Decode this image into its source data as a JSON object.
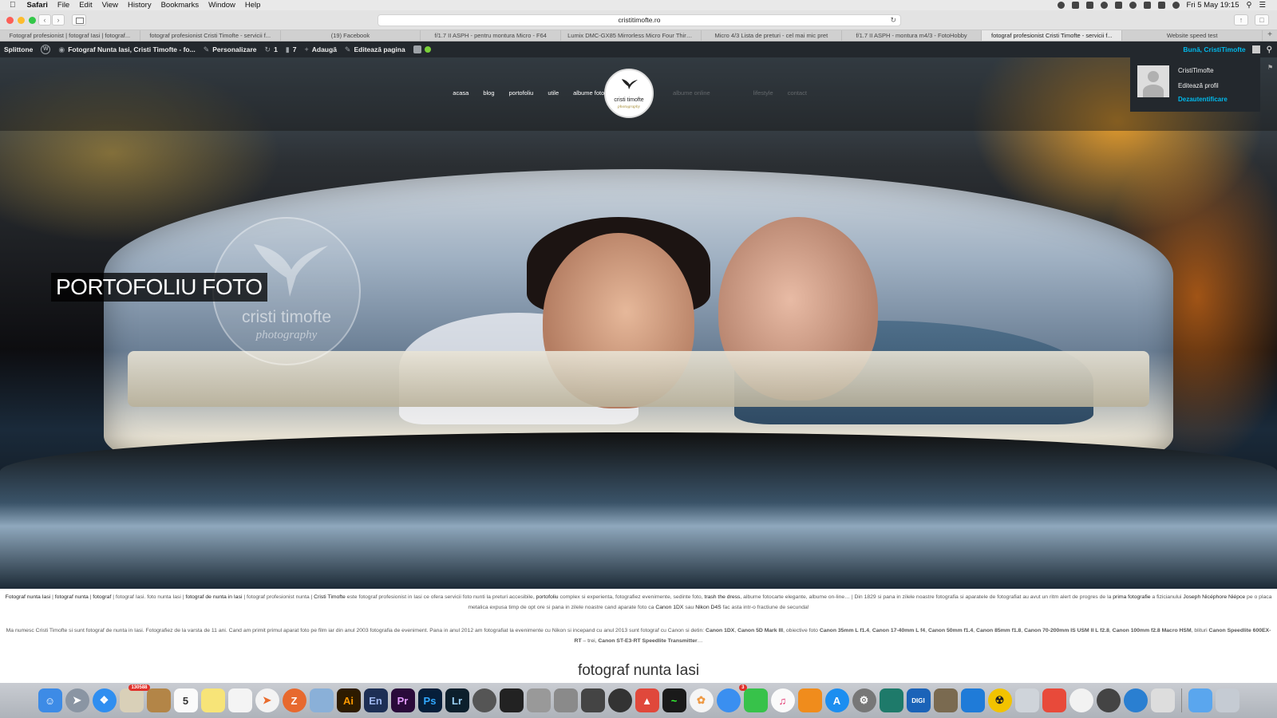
{
  "menubar": {
    "app": "Safari",
    "items": [
      "File",
      "Edit",
      "View",
      "History",
      "Bookmarks",
      "Window",
      "Help"
    ],
    "clock": "Fri 5 May  19:15"
  },
  "browser": {
    "url": "cristitimofte.ro",
    "tabs": [
      "Fotograf profesionist | fotograf Iasi | fotograf...",
      "fotograf profesionist Cristi Timofte - servicii f...",
      "(19) Facebook",
      "f/1.7 II ASPH - pentru montura Micro - F64",
      "Lumix DMC-GX85 Mirrorless Micro Four Third...",
      "Micro 4/3 Lista de preturi - cel mai mic pret",
      "f/1.7 II ASPH - montura m4/3 - FotoHobby",
      "fotograf profesionist Cristi Timofte - servicii f...",
      "Website speed test"
    ],
    "active_tab_index": 7
  },
  "adminbar": {
    "splittone": "Splittone",
    "site_title": "Fotograf Nunta Iasi, Cristi Timofte - fo...",
    "customize": "Personalizare",
    "updates_count": "1",
    "comments_count": "7",
    "add_new": "Adaugă",
    "edit_page": "Editează pagina",
    "howdy": "Bună, CristiTimofte"
  },
  "profile_menu": {
    "username": "CristiTimofte",
    "edit_profile": "Editează profil",
    "logout": "Dezautentificare"
  },
  "site_nav": {
    "left": [
      "acasa",
      "blog",
      "portofoliu",
      "utile",
      "albume fotocarte"
    ],
    "right": [
      "albume online",
      "",
      "",
      "lifestyle",
      "contact"
    ]
  },
  "logo": {
    "name": "cristi timofte",
    "sub": "photography"
  },
  "hero": {
    "title": "PORTOFOLIU FOTO",
    "watermark_name": "cristi timofte",
    "watermark_sub": "photography"
  },
  "intro": {
    "seg_1": "Fotograf nunta Iasi",
    "seg_2": " | ",
    "seg_3": "fotograf nunta",
    "seg_4": " | ",
    "seg_5": "fotograf",
    "seg_6": " | fotograf Iasi. foto nunta Iasi | ",
    "seg_7": "fotograf de nunta in Iasi",
    "seg_8": " | fotograf profesionist nunta | ",
    "seg_9": "Cristi Timofte",
    "seg_10": " este fotograf profesionist in Iasi ce ofera servicii foto nunti la preturi accesibile, ",
    "seg_11": "portofoliu",
    "seg_12": " complex si experienta, fotografiez evenimente, sedinte foto, ",
    "seg_13": "trash the dress",
    "seg_14": ", albume fotocarte elegante, albume on-line… | Din 1829 si pana in zilele noastre fotografia si aparatele de fotografiat au avut un ritm alert de progres de la ",
    "seg_15": "prima fotografie",
    "seg_16": " a fizicianului ",
    "seg_17": "Joseph Nicéphore Niépce",
    "seg_18": " pe o placa metalica expusa timp de opt ore si pana in zilele noastre cand aparate foto ca ",
    "seg_19": "Canon 1DX",
    "seg_20": " sau ",
    "seg_21": "Nikon D4S",
    "seg_22": " fac asta intr-o fractiune de secunda!"
  },
  "about": {
    "seg_1": "Ma numesc Cristi Timofte si sunt fotograf de nunta in Iasi. Fotografiez de la varsta de 11 ani. Cand am primit primul aparat foto pe film iar din anul 2003 fotografia de eveniment. Pana in anul 2012 am fotografiat la evenimente cu Nikon si incepand cu anul 2013 sunt fotograf cu Canon si detin: ",
    "seg_2": "Canon 1DX",
    "seg_3": ",  ",
    "seg_4": "Canon 5D Mark III",
    "seg_5": ", obiective foto ",
    "seg_6": "Canon 35mm L f1.4",
    "seg_7": ", ",
    "seg_8": "Canon 17-40mm L f4",
    "seg_9": ", ",
    "seg_10": "Canon 50mm f1.4",
    "seg_11": ", ",
    "seg_12": "Canon 85mm f1.8",
    "seg_13": ", ",
    "seg_14": "Canon 70-200mm IS USM II L f2.8",
    "seg_15": ", ",
    "seg_16": "Canon 100mm f2.8 Macro HSM",
    "seg_17": ", blituri ",
    "seg_18": "Canon Speedlite 600EX-RT",
    "seg_19": " – trei, ",
    "seg_20": "Canon ST-E3-RT Speedlite Transmitter",
    "seg_21": "…"
  },
  "section_heading": "fotograf nunta Iasi",
  "dock": {
    "badge_mail": "130588",
    "badge_calendar": "5",
    "badge_messages": "3",
    "illustrator": "Ai",
    "encore": "En",
    "premiere": "Pr",
    "photoshop": "Ps",
    "lightroom": "Lr",
    "digi": "DIGI"
  }
}
